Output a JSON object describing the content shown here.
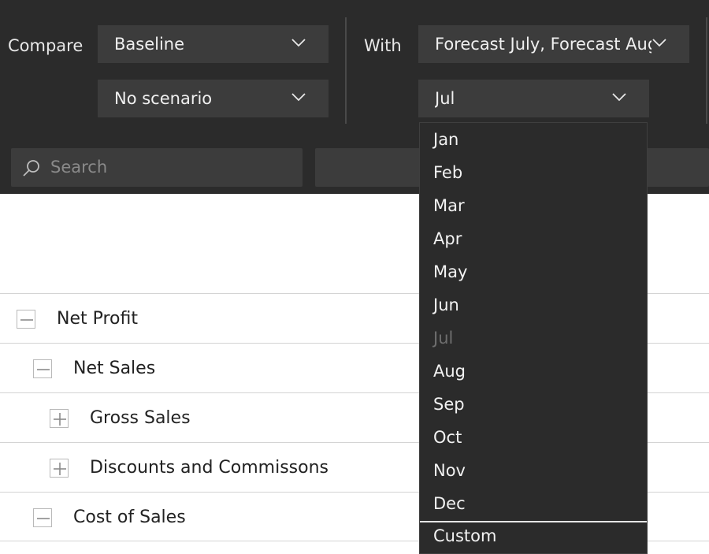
{
  "toolbar": {
    "compare_label": "Compare",
    "with_label": "With",
    "compare_value": "Baseline",
    "scenario_value": "No scenario",
    "with_value": "Forecast July, Forecast Aug",
    "month_value": "Jul"
  },
  "search": {
    "placeholder": "Search",
    "value": ""
  },
  "rows": [
    {
      "label": "Net Profit",
      "toggle": "collapse"
    },
    {
      "label": "Net Sales",
      "toggle": "collapse"
    },
    {
      "label": "Gross Sales",
      "toggle": "expand"
    },
    {
      "label": "Discounts and Commissons",
      "toggle": "expand"
    },
    {
      "label": "Cost of Sales",
      "toggle": "collapse"
    }
  ],
  "month_menu": {
    "items": [
      "Jan",
      "Feb",
      "Mar",
      "Apr",
      "May",
      "Jun",
      "Jul",
      "Aug",
      "Sep",
      "Oct",
      "Nov",
      "Dec"
    ],
    "disabled_item": "Jul",
    "custom_label": "Custom"
  },
  "colors": {
    "toolbar_bg": "#2b2b2b",
    "control_bg": "#3c3c3c",
    "text_light": "#f0f0f0",
    "disabled_text": "#6e6e6e",
    "row_border": "#d4d4d4"
  }
}
